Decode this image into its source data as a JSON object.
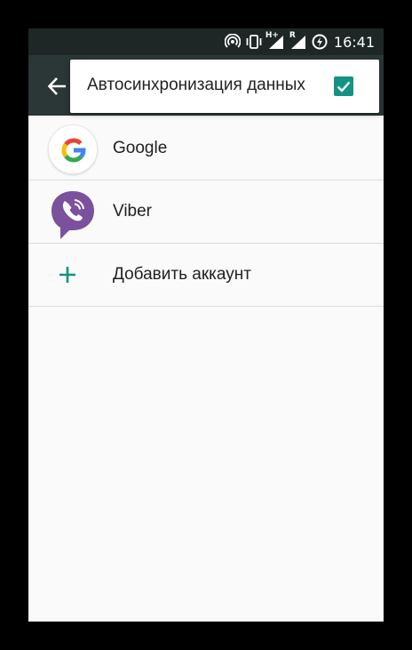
{
  "status_bar": {
    "network_label": "H+",
    "roaming_label": "R",
    "time": "16:41"
  },
  "app_bar": {
    "back_icon": "arrow-left-icon"
  },
  "overflow_menu": {
    "auto_sync_label": "Автосинхронизация данных",
    "auto_sync_checked": true
  },
  "accounts": [
    {
      "label": "Google",
      "icon": "google-icon"
    },
    {
      "label": "Viber",
      "icon": "viber-icon"
    },
    {
      "label": "Добавить аккаунт",
      "icon": "plus-icon"
    }
  ],
  "colors": {
    "accent": "#139383",
    "status_bar": "#1e2626",
    "app_bar": "#2b3636",
    "viber": "#7b519d",
    "google_blue": "#4285f4",
    "google_red": "#ea4335",
    "google_yellow": "#fbbc05",
    "google_green": "#34a853"
  }
}
